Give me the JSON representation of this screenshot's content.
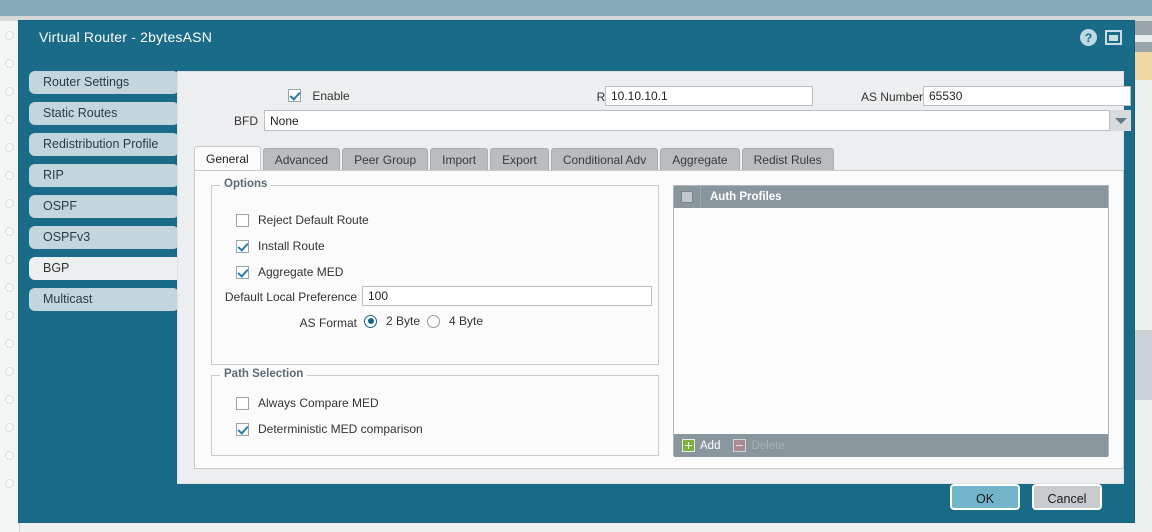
{
  "window": {
    "title": "Virtual Router - 2bytesASN",
    "help_icon": "help-circle-icon",
    "restore_icon": "restore-window-icon"
  },
  "sidebar": {
    "items": [
      {
        "label": "Router Settings",
        "active": false
      },
      {
        "label": "Static Routes",
        "active": false
      },
      {
        "label": "Redistribution Profile",
        "active": false
      },
      {
        "label": "RIP",
        "active": false
      },
      {
        "label": "OSPF",
        "active": false
      },
      {
        "label": "OSPFv3",
        "active": false
      },
      {
        "label": "BGP",
        "active": true
      },
      {
        "label": "Multicast",
        "active": false
      }
    ]
  },
  "form": {
    "enable": {
      "label": "Enable",
      "checked": true
    },
    "router_id": {
      "label": "Router ID",
      "value": "10.10.10.1"
    },
    "as_number": {
      "label": "AS Number",
      "value": "65530"
    },
    "bfd": {
      "label": "BFD",
      "value": "None"
    }
  },
  "tabs": [
    {
      "label": "General",
      "active": true
    },
    {
      "label": "Advanced",
      "active": false
    },
    {
      "label": "Peer Group",
      "active": false
    },
    {
      "label": "Import",
      "active": false
    },
    {
      "label": "Export",
      "active": false
    },
    {
      "label": "Conditional Adv",
      "active": false
    },
    {
      "label": "Aggregate",
      "active": false
    },
    {
      "label": "Redist Rules",
      "active": false
    }
  ],
  "options": {
    "legend": "Options",
    "reject_default_route": {
      "label": "Reject Default Route",
      "checked": false
    },
    "install_route": {
      "label": "Install Route",
      "checked": true
    },
    "aggregate_med": {
      "label": "Aggregate MED",
      "checked": true
    },
    "default_local_preference": {
      "label": "Default Local Preference",
      "value": "100"
    },
    "as_format": {
      "label": "AS Format",
      "choices": [
        {
          "label": "2 Byte",
          "selected": true
        },
        {
          "label": "4 Byte",
          "selected": false
        }
      ]
    }
  },
  "path_selection": {
    "legend": "Path Selection",
    "always_compare_med": {
      "label": "Always Compare MED",
      "checked": false
    },
    "deterministic_med": {
      "label": "Deterministic MED comparison",
      "checked": true
    }
  },
  "auth_profiles": {
    "header": "Auth Profiles",
    "rows": [],
    "add_label": "Add",
    "delete_label": "Delete",
    "delete_enabled": false
  },
  "footer": {
    "ok_label": "OK",
    "cancel_label": "Cancel"
  },
  "colors": {
    "dialog_teal": "#1a6b87",
    "nav_item": "#c3d5dd",
    "accent_blue": "#2b7ca3",
    "ok_button": "#72b4ca",
    "cancel_button": "#c8cbcd",
    "panel_header": "#8a969d"
  }
}
